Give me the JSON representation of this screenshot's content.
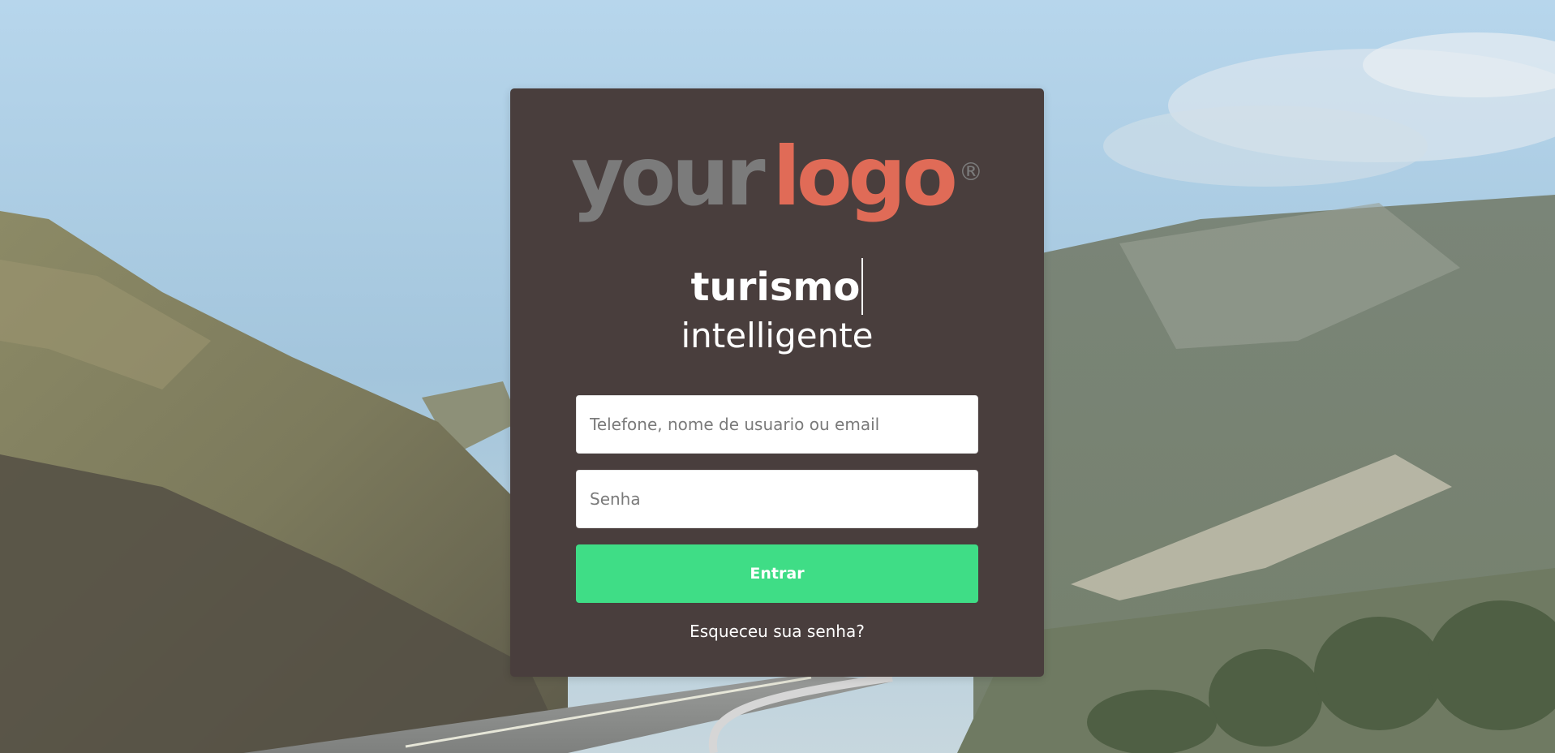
{
  "logo": {
    "word_1": "your",
    "word_2": "logo",
    "registered": "®"
  },
  "tagline": {
    "line_1": "turismo",
    "line_2": "intelligente"
  },
  "form": {
    "user_placeholder": "Telefone, nome de usuario ou email",
    "password_placeholder": "Senha",
    "submit_label": "Entrar",
    "forgot_label": "Esqueceu sua senha?"
  },
  "colors": {
    "card_background": "#493e3d",
    "logo_gray": "#7b7b7b",
    "logo_accent": "#e06b57",
    "button_green": "#3fdd86"
  }
}
